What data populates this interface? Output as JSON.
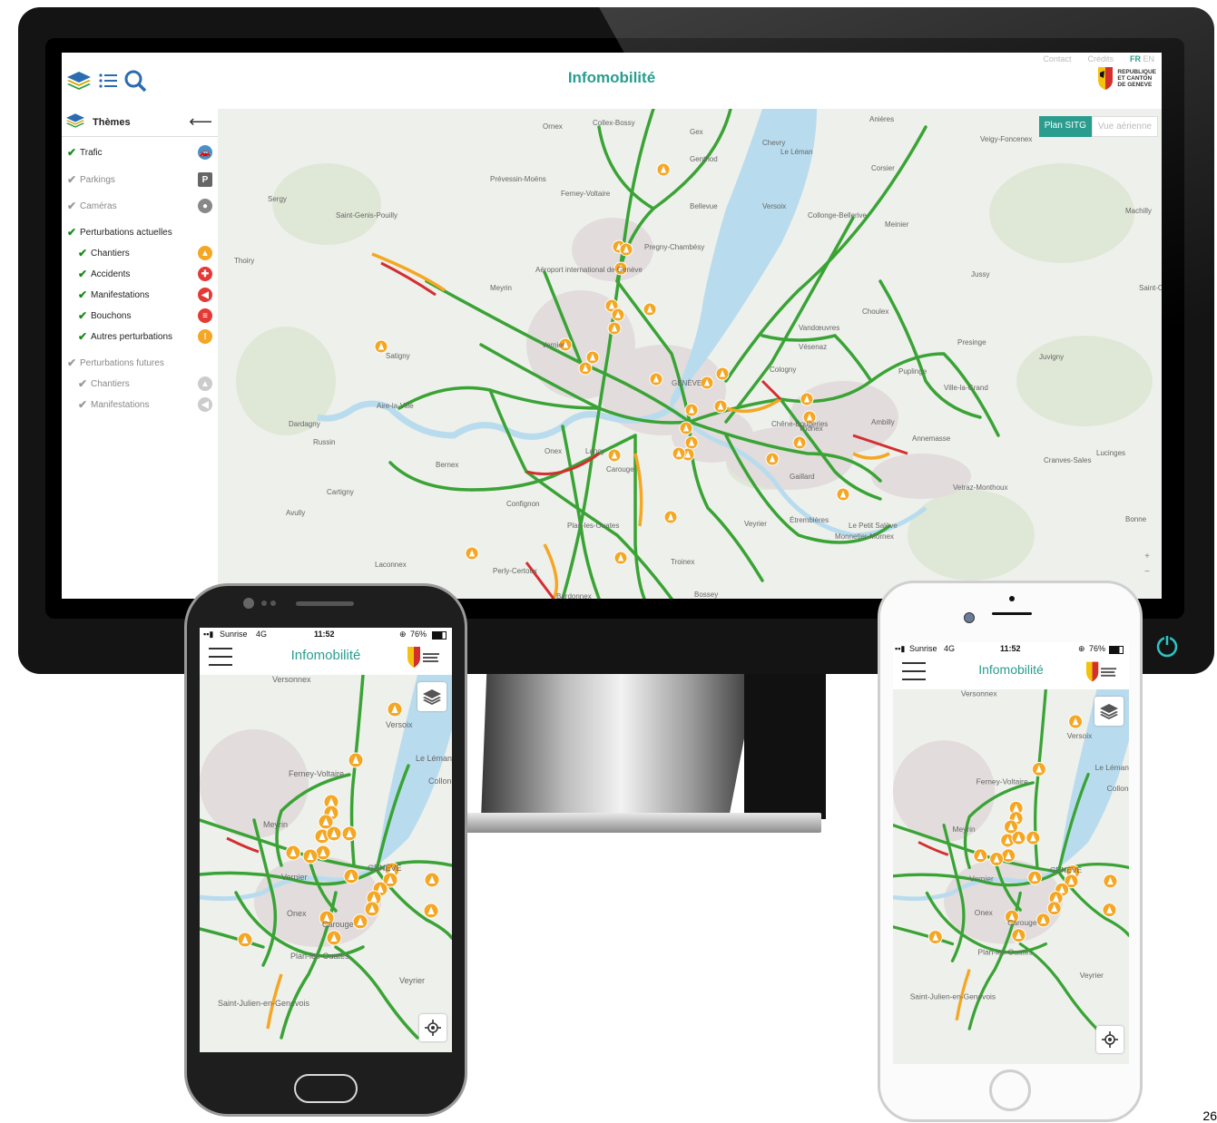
{
  "desktop": {
    "title": "Infomobilité",
    "header_links": [
      "Contact",
      "Crédits"
    ],
    "languages": [
      "FR",
      "EN"
    ],
    "logo_lines": [
      "REPUBLIQUE",
      "ET CANTON",
      "DE GENEVE"
    ],
    "sidebar": {
      "heading": "Thèmes",
      "items": [
        {
          "label": "Trafic",
          "checked": true,
          "icon": "traffic-car-icon",
          "color": "#4a90c8"
        },
        {
          "label": "Parkings",
          "checked": false,
          "icon": "parking-icon",
          "color": "#666666"
        },
        {
          "label": "Caméras",
          "checked": false,
          "icon": "camera-icon",
          "color": "#888888"
        },
        {
          "label": "Perturbations actuelles",
          "checked": true
        },
        {
          "label": "Chantiers",
          "checked": true,
          "icon": "roadwork-cone-icon",
          "color": "#f5a623"
        },
        {
          "label": "Accidents",
          "checked": true,
          "icon": "accident-icon",
          "color": "#e53935"
        },
        {
          "label": "Manifestations",
          "checked": true,
          "icon": "megaphone-icon",
          "color": "#e53935"
        },
        {
          "label": "Bouchons",
          "checked": true,
          "icon": "traffic-jam-icon",
          "color": "#e53935"
        },
        {
          "label": "Autres perturbations",
          "checked": true,
          "icon": "exclamation-icon",
          "color": "#f5a623"
        },
        {
          "label": "Perturbations futures",
          "checked": false
        },
        {
          "label": "Chantiers",
          "checked": false,
          "icon": "roadwork-cone-icon",
          "color": "#cccccc"
        },
        {
          "label": "Manifestations",
          "checked": false,
          "icon": "megaphone-icon",
          "color": "#cccccc"
        }
      ]
    },
    "map_toggle": {
      "active": "Plan SITG",
      "inactive": "Vue aérienne"
    },
    "zoom": [
      "+",
      "−"
    ],
    "place_labels": [
      "Ornex",
      "Collex-Bossy",
      "Gex",
      "Chevry",
      "Sergy",
      "Prévessin-Moëns",
      "Ferney-Voltaire",
      "Genthod",
      "Bellevue",
      "Versoix",
      "Saint-Genis-Pouilly",
      "Pregny-Chambésy",
      "Thoiry",
      "Meyrin",
      "Aéroport international de Genève",
      "Vernier",
      "Satigny",
      "GENÈVE",
      "Cologny",
      "Vandœuvres",
      "Choulex",
      "Puplinge",
      "Collonge-Bellerive",
      "Meinier",
      "Jussy",
      "Presinge",
      "Vésenaz",
      "Dardagny",
      "Russin",
      "Aire-la-Ville",
      "Onex",
      "Lancy",
      "Carouge",
      "Chêne-Bougeries",
      "Thônex",
      "Ambilly",
      "Annemasse",
      "Ville-la-Grand",
      "Juvigny",
      "Bernex",
      "Confignon",
      "Cartigny",
      "Avully",
      "Plan-les-Ouates",
      "Troinex",
      "Veyrier",
      "Gaillard",
      "Étrembières",
      "Le Petit Salève",
      "Monnetier-Mornex",
      "Perly-Certoux",
      "Laconnex",
      "Bardonnex",
      "Bossey",
      "Cranves-Sales",
      "Vetraz-Monthoux",
      "Lucinges",
      "Bonne",
      "Machilly",
      "Saint-Cergues",
      "Veigy-Foncenex",
      "Corsier",
      "Le Léman",
      "Anières"
    ]
  },
  "android": {
    "carrier": "Sunrise",
    "network": "4G",
    "time": "11:52",
    "battery": "76%",
    "title": "Infomobilité",
    "place_labels": [
      "Versonnex",
      "Versoix",
      "Ferney-Voltaire",
      "Collonge-Bellerive",
      "Meyrin",
      "Vernier",
      "GENÈVE",
      "Onex",
      "Carouge",
      "Plan-les-Ouates",
      "Veyrier",
      "Saint-Julien-en-Genevois",
      "Le Léman"
    ]
  },
  "iphone": {
    "carrier": "Sunrise",
    "network": "4G",
    "time": "11:52",
    "battery": "76%",
    "title": "Infomobilité",
    "place_labels": [
      "Versonnex",
      "Versoix",
      "Ferney-Voltaire",
      "Collonge-Bellerive",
      "Meyrin",
      "Vernier",
      "GENÈVE",
      "Onex",
      "Carouge",
      "Plan-les-Ouates",
      "Veyrier",
      "Saint-Julien-en-Genevois",
      "Le Léman"
    ]
  },
  "page_number": "26",
  "colors": {
    "accent": "#2a9d8f",
    "road_ok": "#3aa335",
    "road_slow": "#f5a623",
    "road_jam": "#d32f2f",
    "roadwork": "#f5a623",
    "lake": "#b8dcee"
  }
}
